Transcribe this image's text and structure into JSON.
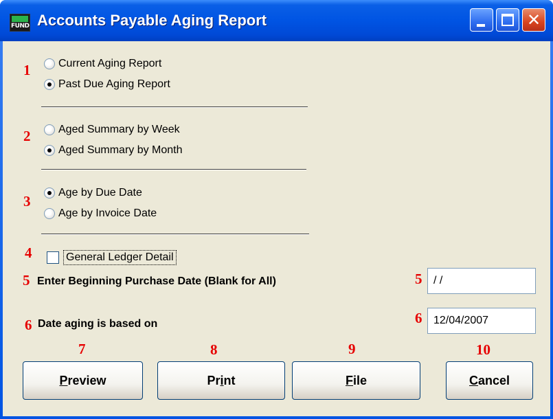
{
  "window": {
    "title": "Accounts Payable Aging Report",
    "icon_text": "FUND"
  },
  "markers": [
    "1",
    "2",
    "3",
    "4",
    "5",
    "5",
    "6",
    "6",
    "7",
    "8",
    "9",
    "10"
  ],
  "group1": {
    "options": [
      {
        "label": "Current Aging Report",
        "checked": false
      },
      {
        "label": "Past Due Aging Report",
        "checked": true
      }
    ]
  },
  "group2": {
    "options": [
      {
        "label": "Aged Summary by Week",
        "checked": false
      },
      {
        "label": "Aged Summary by Month",
        "checked": true
      }
    ]
  },
  "group3": {
    "options": [
      {
        "label": "Age by Due Date",
        "checked": true
      },
      {
        "label": "Age by Invoice Date",
        "checked": false
      }
    ]
  },
  "gl_detail": {
    "label": "General Ledger Detail",
    "checked": false
  },
  "purchase_date": {
    "label": "Enter Beginning Purchase Date (Blank for All)",
    "value": " / /"
  },
  "aging_date": {
    "label": "Date aging is based on",
    "value": "12/04/2007"
  },
  "buttons": {
    "preview": {
      "first": "P",
      "rest": "review"
    },
    "print": {
      "first": "Pr",
      "u": "i",
      "rest": "nt"
    },
    "file": {
      "first": "F",
      "rest": "ile"
    },
    "cancel": {
      "first": "C",
      "rest": "ancel"
    }
  },
  "colors": {
    "accent_red": "#e60000",
    "title_blue": "#0054e3",
    "client_bg": "#ece9d8"
  }
}
